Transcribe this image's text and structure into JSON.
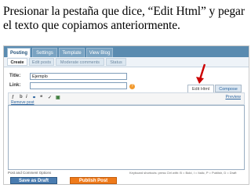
{
  "caption": "Presionar la pestaña que dice, “Edit Html” y pegar el texto que copiamos anteriormente.",
  "tabs": [
    {
      "label": "Posting"
    },
    {
      "label": "Settings"
    },
    {
      "label": "Template"
    },
    {
      "label": "View Blog"
    }
  ],
  "subtabs": [
    {
      "label": "Create"
    },
    {
      "label": "Edit posts"
    },
    {
      "label": "Moderate comments"
    },
    {
      "label": "Status"
    }
  ],
  "form": {
    "title_label": "Title:",
    "title_value": "Ejemplo",
    "link_label": "Link:"
  },
  "help_glyph": "?",
  "modes": {
    "edit_html": "Edit Html",
    "compose": "Compose"
  },
  "toolbar": {
    "preview": "Preview",
    "remove_link": "Remove post"
  },
  "footer": {
    "options": "Post and Comment Options",
    "shortcuts": "Keyboard shortcuts: press Ctrl with: B = Bold, I = Italic, P = Publish, D = Draft"
  },
  "buttons": {
    "save_draft": "Save as Draft",
    "publish": "Publish Post"
  },
  "colors": {
    "tab_bar": "#5a8bb0",
    "publish": "#ef7a1a",
    "draft": "#4a7cb0",
    "arrow": "#cc0000"
  }
}
